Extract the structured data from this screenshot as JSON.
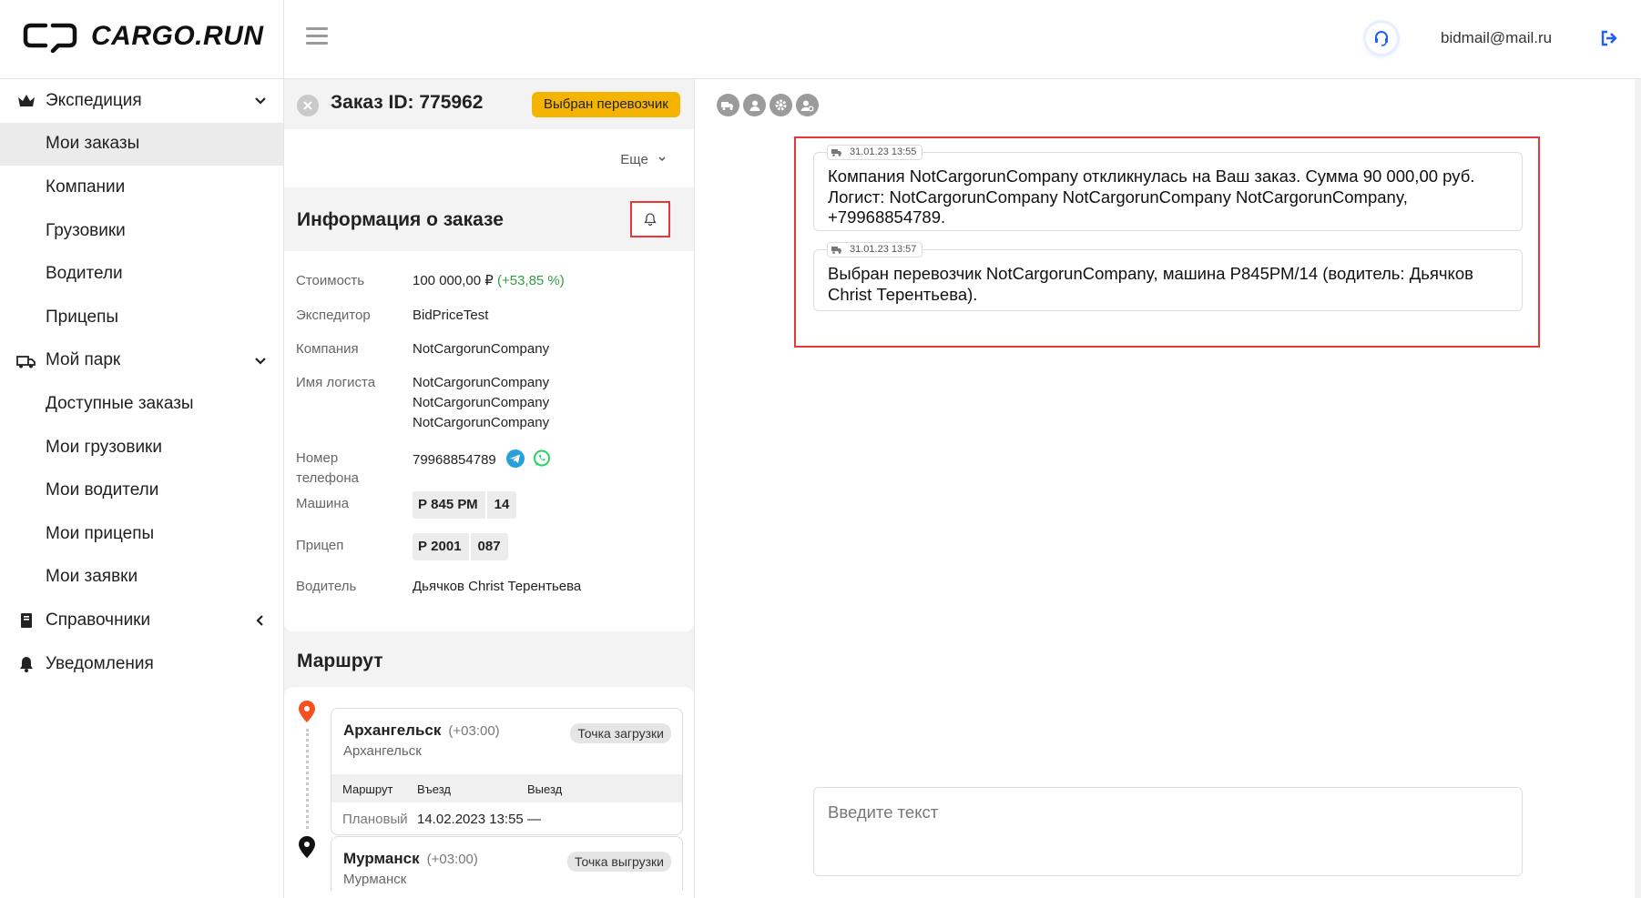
{
  "brand": {
    "name": "CARGO.RUN"
  },
  "header": {
    "email": "bidmail@mail.ru"
  },
  "sidebar": {
    "items": [
      {
        "label": "Экспедиция",
        "type": "parent",
        "icon": "crown-icon",
        "chevron": "down"
      },
      {
        "label": "Мои заказы",
        "type": "child",
        "active": true
      },
      {
        "label": "Компании",
        "type": "child"
      },
      {
        "label": "Грузовики",
        "type": "child"
      },
      {
        "label": "Водители",
        "type": "child"
      },
      {
        "label": "Прицепы",
        "type": "child"
      },
      {
        "label": "Мой парк",
        "type": "parent",
        "icon": "truck-icon",
        "chevron": "down"
      },
      {
        "label": "Доступные заказы",
        "type": "child"
      },
      {
        "label": "Мои грузовики",
        "type": "child"
      },
      {
        "label": "Мои водители",
        "type": "child"
      },
      {
        "label": "Мои прицепы",
        "type": "child"
      },
      {
        "label": "Мои заявки",
        "type": "child"
      },
      {
        "label": "Справочники",
        "type": "parent",
        "icon": "book-icon",
        "chevron": "left"
      },
      {
        "label": "Уведомления",
        "type": "parent",
        "icon": "bell-icon"
      }
    ]
  },
  "order": {
    "title": "Заказ ID: 775962",
    "status": "Выбран перевозчик",
    "more_label": "Еще",
    "info_title": "Информация о заказе",
    "fields": {
      "cost_label": "Стоимость",
      "cost_value": "100 000,00 ₽",
      "cost_pct": "(+53,85 %)",
      "forwarder_label": "Экспедитор",
      "forwarder_value": "BidPriceTest",
      "company_label": "Компания",
      "company_value": "NotCargorunCompany",
      "logist_label": "Имя логиста",
      "logist_value_1": "NotCargorunCompany",
      "logist_value_2": "NotCargorunCompany",
      "logist_value_3": "NotCargorunCompany",
      "phone_label_1": "Номер",
      "phone_label_2": "телефона",
      "phone_value": "79968854789",
      "truck_label": "Машина",
      "truck_plate": "Р 845 РМ",
      "truck_region": "14",
      "trailer_label": "Прицеп",
      "trailer_plate": "Р 2001",
      "trailer_region": "087",
      "driver_label": "Водитель",
      "driver_value": "Дьячков Christ Терентьева"
    },
    "route_title": "Маршрут",
    "stops": [
      {
        "city": "Архангельск",
        "tz": "(+03:00)",
        "sub": "Архангельск",
        "tag": "Точка загрузки",
        "col_route": "Маршрут",
        "col_in": "Въезд",
        "col_out": "Выезд",
        "row_label": "Плановый",
        "row_in": "14.02.2023 13:55",
        "row_out": "—",
        "pin_color": "#f4511e"
      },
      {
        "city": "Мурманск",
        "tz": "(+03:00)",
        "sub": "Мурманск",
        "tag": "Точка выгрузки",
        "pin_color": "#111111"
      }
    ]
  },
  "chat": {
    "messages": [
      {
        "time": "31.01.23 13:55",
        "text": "Компания NotCargorunCompany откликнулась на Ваш заказ. Сумма 90 000,00 руб. Логист: NotCargorunCompany NotCargorunCompany NotCargorunCompany, +79968854789."
      },
      {
        "time": "31.01.23 13:57",
        "text": "Выбран перевозчик NotCargorunCompany, машина Р845РМ/14 (водитель: Дьячков Christ Терентьева)."
      }
    ],
    "input_placeholder": "Введите текст"
  },
  "colors": {
    "accent": "#f5b400",
    "highlight": "#e53935",
    "link": "#1e5eff",
    "positive": "#2e9d3e"
  }
}
